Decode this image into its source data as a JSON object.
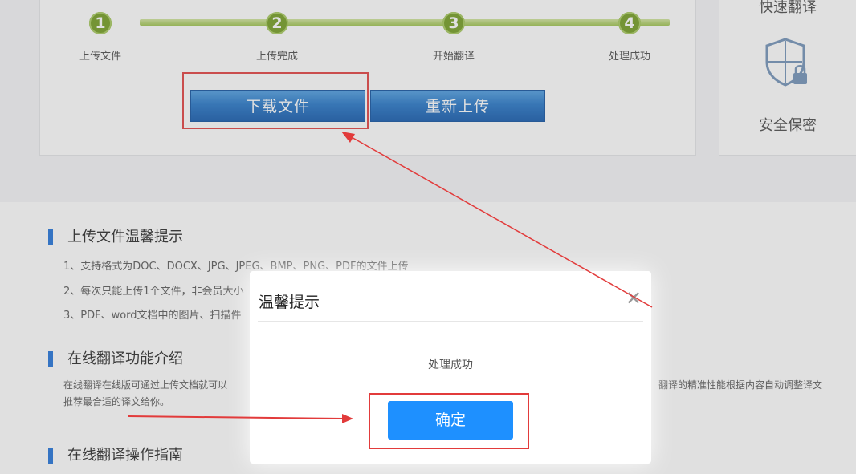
{
  "steps": [
    {
      "num": "1",
      "label": "上传文件"
    },
    {
      "num": "2",
      "label": "上传完成"
    },
    {
      "num": "3",
      "label": "开始翻译"
    },
    {
      "num": "4",
      "label": "处理成功"
    }
  ],
  "buttons": {
    "download": "下载文件",
    "reupload": "重新上传"
  },
  "side": {
    "top_label": "快速翻译",
    "security_label": "安全保密"
  },
  "sections": {
    "upload_tips_title": "上传文件温馨提示",
    "tips": [
      "1、支持格式为DOC、DOCX、JPG、JPEG、BMP、PNG、PDF的文件上传",
      "2、每次只能上传1个文件，非会员大小",
      "3、PDF、word文档中的图片、扫描件"
    ],
    "intro_title": "在线翻译功能介绍",
    "intro_left": "在线翻译在线版可通过上传文档就可以",
    "intro_right": "翻译的精准性能根据内容自动调整译文",
    "intro_line2": "推荐最合适的译文给你。",
    "guide_title": "在线翻译操作指南"
  },
  "dialog": {
    "title": "温馨提示",
    "close_glyph": "✕",
    "message": "处理成功",
    "confirm": "确定"
  },
  "colors": {
    "primary_blue": "#1e90ff",
    "step_green": "#6f9a1b",
    "highlight_red": "#e23b3b"
  }
}
